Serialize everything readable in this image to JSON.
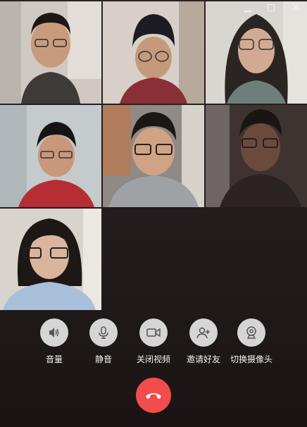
{
  "participants": [
    {
      "id": "participant-1"
    },
    {
      "id": "participant-2"
    },
    {
      "id": "participant-3"
    },
    {
      "id": "participant-4"
    },
    {
      "id": "participant-5"
    },
    {
      "id": "participant-6"
    },
    {
      "id": "participant-7"
    }
  ],
  "window_controls": {
    "minimize_icon": "minimize-icon",
    "maximize_icon": "maximize-icon",
    "close_icon": "close-icon",
    "close_glyph": "×"
  },
  "controls": {
    "volume_label": "音量",
    "mute_label": "静音",
    "video_off_label": "关闭视频",
    "invite_label": "邀请好友",
    "switch_camera_label": "切换摄像头"
  },
  "icons": {
    "volume": "speaker-icon",
    "mute": "microphone-icon",
    "video": "video-camera-icon",
    "invite": "add-person-icon",
    "switch_camera": "webcam-icon",
    "hangup": "hang-up-phone-icon"
  },
  "colors": {
    "hangup": "#f24c4c",
    "control_circle": "#e8e8e8",
    "background": "#221b1b"
  }
}
